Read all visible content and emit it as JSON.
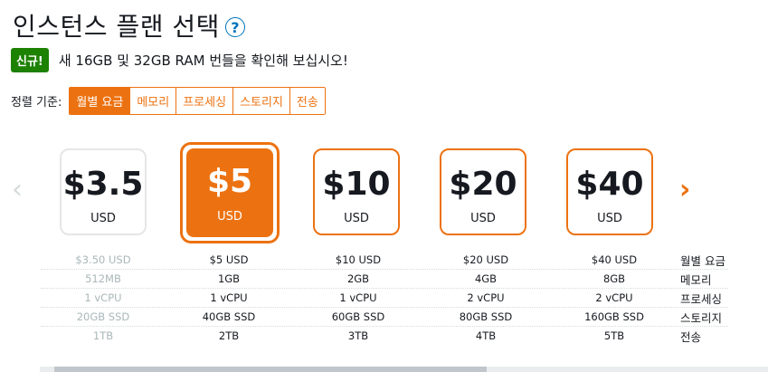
{
  "header": {
    "title": "인스턴스 플랜 선택",
    "help_glyph": "?"
  },
  "notice": {
    "badge": "신규!",
    "text": "새 16GB 및 32GB RAM 번들을 확인해 보십시오!"
  },
  "sort": {
    "label": "정렬 기준:",
    "options": [
      "월별 요금",
      "메모리",
      "프로세싱",
      "스토리지",
      "전송"
    ],
    "active_index": 0
  },
  "carousel": {
    "prev_icon": "chevron-left-icon",
    "next_icon": "chevron-right-icon"
  },
  "plans": [
    {
      "price": "$3.5",
      "currency": "USD",
      "state": "dimmed"
    },
    {
      "price": "$5",
      "currency": "USD",
      "state": "selected"
    },
    {
      "price": "$10",
      "currency": "USD",
      "state": "normal"
    },
    {
      "price": "$20",
      "currency": "USD",
      "state": "normal"
    },
    {
      "price": "$40",
      "currency": "USD",
      "state": "normal"
    }
  ],
  "specs": {
    "labels": [
      "월별 요금",
      "메모리",
      "프로세싱",
      "스토리지",
      "전송"
    ],
    "rows": [
      [
        "$3.50 USD",
        "$5 USD",
        "$10 USD",
        "$20 USD",
        "$40 USD"
      ],
      [
        "512MB",
        "1GB",
        "2GB",
        "4GB",
        "8GB"
      ],
      [
        "1 vCPU",
        "1 vCPU",
        "1 vCPU",
        "2 vCPU",
        "2 vCPU"
      ],
      [
        "20GB SSD",
        "40GB SSD",
        "60GB SSD",
        "80GB SSD",
        "160GB SSD"
      ],
      [
        "1TB",
        "2TB",
        "3TB",
        "4TB",
        "5TB"
      ]
    ]
  },
  "colors": {
    "accent": "#ec7211",
    "badge": "#1d8102",
    "help": "#0073bb",
    "dim_text": "#aab7b8"
  }
}
